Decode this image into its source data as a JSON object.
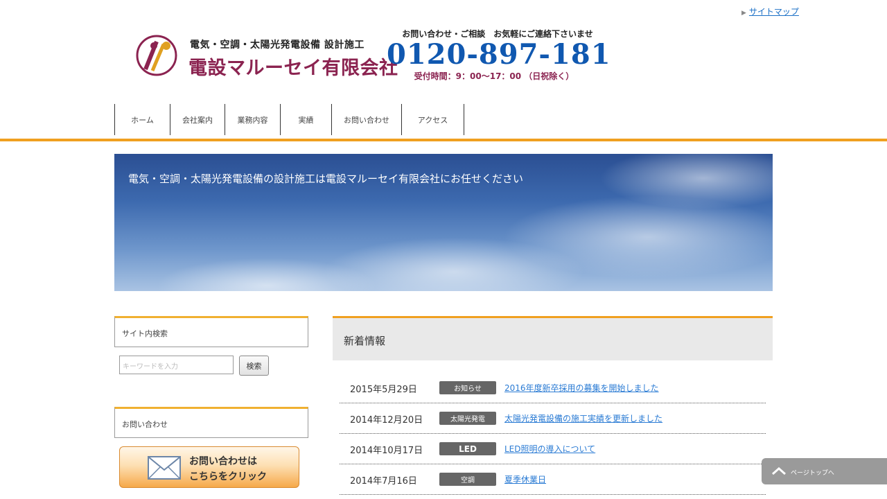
{
  "header": {
    "top_link": "サイトマップ",
    "logo_line1": "電気・空調・太陽光発電設備 設計施工",
    "logo_line2": "電設マルーセイ有限会社",
    "phone_note": "お問い合わせ・ご相談　お気軽にご連絡下さいませ",
    "phone_number": "0120-897-181",
    "phone_hours": "受付時間：9：00～17：00 （日祝除く）"
  },
  "nav": {
    "items": [
      {
        "label": "ホーム"
      },
      {
        "label": "会社案内"
      },
      {
        "label": "業務内容"
      },
      {
        "label": "実績"
      },
      {
        "label": "お問い合わせ"
      },
      {
        "label": "アクセス"
      }
    ]
  },
  "hero": {
    "tagline": "電気・空調・太陽光発電設備の設計施工は電設マルーセイ有限会社にお任せください"
  },
  "sidebar": {
    "search_heading": "サイト内検索",
    "search_placeholder": "キーワードを入力",
    "search_button": "検索",
    "contact_heading": "お問い合わせ",
    "contact_line1": "お問い合わせは",
    "contact_line2": "こちらをクリック"
  },
  "news": {
    "heading": "新着情報",
    "rows": [
      {
        "date": "2015年5月29日",
        "category": "お知らせ",
        "title": "2016年度新卒採用の募集を開始しました"
      },
      {
        "date": "2014年12月20日",
        "category": "太陽光発電",
        "title": "太陽光発電設備の施工実績を更新しました"
      },
      {
        "date": "2014年10月17日",
        "category": "LED",
        "title": "LED照明の導入について"
      },
      {
        "date": "2014年7月16日",
        "category": "空調",
        "title": "夏季休業日"
      }
    ]
  },
  "pagetop": {
    "label": "ページトップへ"
  }
}
